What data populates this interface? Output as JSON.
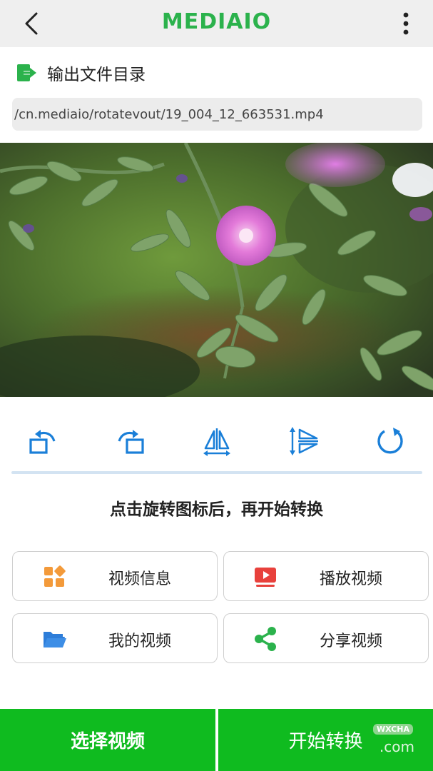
{
  "app_bar": {
    "logo_text": "MEDIAIO",
    "back_icon": "chevron-left-icon",
    "more_icon": "more-vertical-icon"
  },
  "output": {
    "label": "输出文件目录",
    "icon": "export-folder-icon",
    "path": "/cn.mediaio/rotatevout/19_004_12_663531.mp4"
  },
  "tools": [
    {
      "name": "rotate-left-icon"
    },
    {
      "name": "rotate-right-icon"
    },
    {
      "name": "flip-horizontal-icon"
    },
    {
      "name": "flip-vertical-icon"
    },
    {
      "name": "reset-icon"
    }
  ],
  "hint": "点击旋转图标后，再开始转换",
  "cards": {
    "video_info": "视频信息",
    "play_video": "播放视频",
    "my_videos": "我的视频",
    "share_video": "分享视频"
  },
  "bottom": {
    "select_video": "选择视频",
    "start_convert": "开始转换"
  },
  "watermark": {
    "badge": "WXCHA",
    "domain": ".com"
  },
  "colors": {
    "brand_green": "#2bb24c",
    "button_green": "#0fbb1f",
    "tool_blue": "#1a7fd8",
    "orange": "#f39a3a",
    "red": "#e8413c",
    "folder_blue": "#2d7dd9"
  }
}
